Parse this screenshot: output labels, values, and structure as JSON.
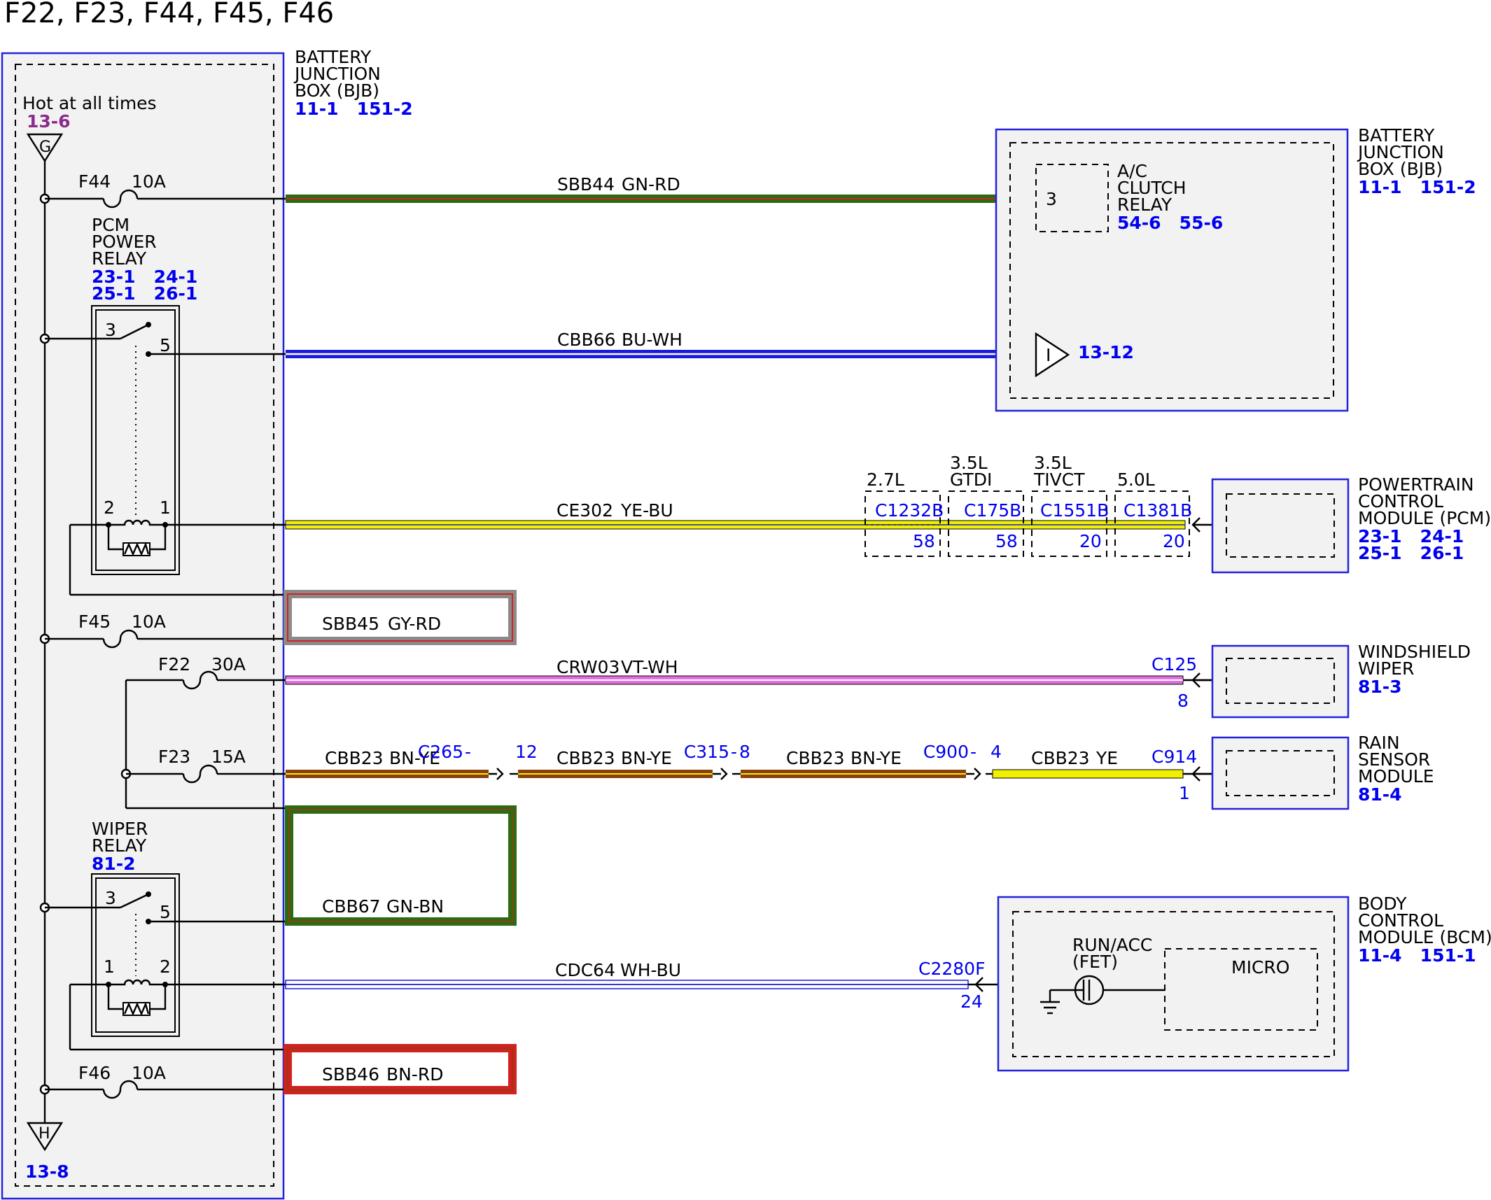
{
  "title": "F22, F23, F44, F45, F46",
  "bjb_left": {
    "name_lines": [
      "BATTERY",
      "JUNCTION",
      "BOX (BJB)"
    ],
    "refs": "11-1   151-2",
    "hot_label": "Hot at all times",
    "top_ref": "13-6",
    "top_bus": "G",
    "bottom_bus": "H",
    "bottom_ref": "13-8"
  },
  "fuses": [
    {
      "id": "F44",
      "rating": "10A"
    },
    {
      "id": "F45",
      "rating": "10A"
    },
    {
      "id": "F22",
      "rating": "30A"
    },
    {
      "id": "F23",
      "rating": "15A"
    },
    {
      "id": "F46",
      "rating": "10A"
    }
  ],
  "pcm_relay": {
    "name_lines": [
      "PCM",
      "POWER",
      "RELAY"
    ],
    "refs_line1": "23-1   24-1",
    "refs_line2": "25-1   26-1",
    "pins": {
      "a": "3",
      "b": "5",
      "c": "2",
      "d": "1"
    }
  },
  "wiper_relay": {
    "name_lines": [
      "WIPER",
      "RELAY"
    ],
    "refs": "81-2",
    "pins": {
      "a": "3",
      "b": "5",
      "c": "1",
      "d": "2"
    }
  },
  "circuits": [
    {
      "id": "SBB44",
      "color": "GN-RD"
    },
    {
      "id": "CBB66",
      "color": "BU-WH"
    },
    {
      "id": "CE302",
      "color": "YE-BU"
    },
    {
      "id": "SBB45",
      "color": "GY-RD"
    },
    {
      "id": "CRW03",
      "color": "VT-WH"
    },
    {
      "id": "CBB23",
      "color": "BN-YE"
    },
    {
      "id": "CBB23",
      "color": "BN-YE"
    },
    {
      "id": "CBB23",
      "color": "BN-YE"
    },
    {
      "id": "CBB23",
      "color": "YE"
    },
    {
      "id": "CBB67",
      "color": "GN-BN"
    },
    {
      "id": "CDC64",
      "color": "WH-BU"
    },
    {
      "id": "SBB46",
      "color": "BN-RD"
    }
  ],
  "bjb_right": {
    "name_lines": [
      "BATTERY",
      "JUNCTION",
      "BOX (BJB)"
    ],
    "refs": "11-1   151-2",
    "ac_relay_lines": [
      "A/C",
      "CLUTCH",
      "RELAY"
    ],
    "ac_relay_refs": "54-6   55-6",
    "ac_relay_pin": "3",
    "i_symbol": "I",
    "i_ref": "13-12"
  },
  "pcm_module": {
    "name_lines": [
      "POWERTRAIN",
      "CONTROL",
      "MODULE (PCM)"
    ],
    "refs_line1": "23-1   24-1",
    "refs_line2": "25-1   26-1",
    "engine_variants": [
      {
        "engine_lines": [
          "2.7L"
        ],
        "connector": "C1232B",
        "pin": "58"
      },
      {
        "engine_lines": [
          "3.5L",
          "GTDI"
        ],
        "connector": "C175B",
        "pin": "58"
      },
      {
        "engine_lines": [
          "3.5L",
          "TIVCT"
        ],
        "connector": "C1551B",
        "pin": "20"
      },
      {
        "engine_lines": [
          "5.0L"
        ],
        "connector": "C1381B",
        "pin": "20"
      }
    ]
  },
  "wiper_module": {
    "name_lines": [
      "WINDSHIELD",
      "WIPER"
    ],
    "refs": "81-3",
    "connector": "C125",
    "pin": "8"
  },
  "rain_module": {
    "name_lines": [
      "RAIN",
      "SENSOR",
      "MODULE"
    ],
    "refs": "81-4",
    "connector": "C914",
    "pin": "1"
  },
  "inline_connectors": [
    {
      "connector": "C265",
      "pin": "12"
    },
    {
      "connector": "C315",
      "pin": "8"
    },
    {
      "connector": "C900",
      "pin": "4"
    }
  ],
  "bcm": {
    "name_lines": [
      "BODY",
      "CONTROL",
      "MODULE (BCM)"
    ],
    "refs": "11-4   151-1",
    "connector": "C2280F",
    "pin": "24",
    "fet_lines": [
      "RUN/ACC",
      "(FET)"
    ],
    "micro": "MICRO"
  },
  "wire_colors": {
    "GN": "#2b6b14",
    "RD": "#d52020",
    "BU": "#1a1adc",
    "WH": "#ffffff",
    "YE": "#f0f000",
    "GY": "#8a8a8a",
    "VT": "#e070e0",
    "BN": "#8b4010"
  }
}
